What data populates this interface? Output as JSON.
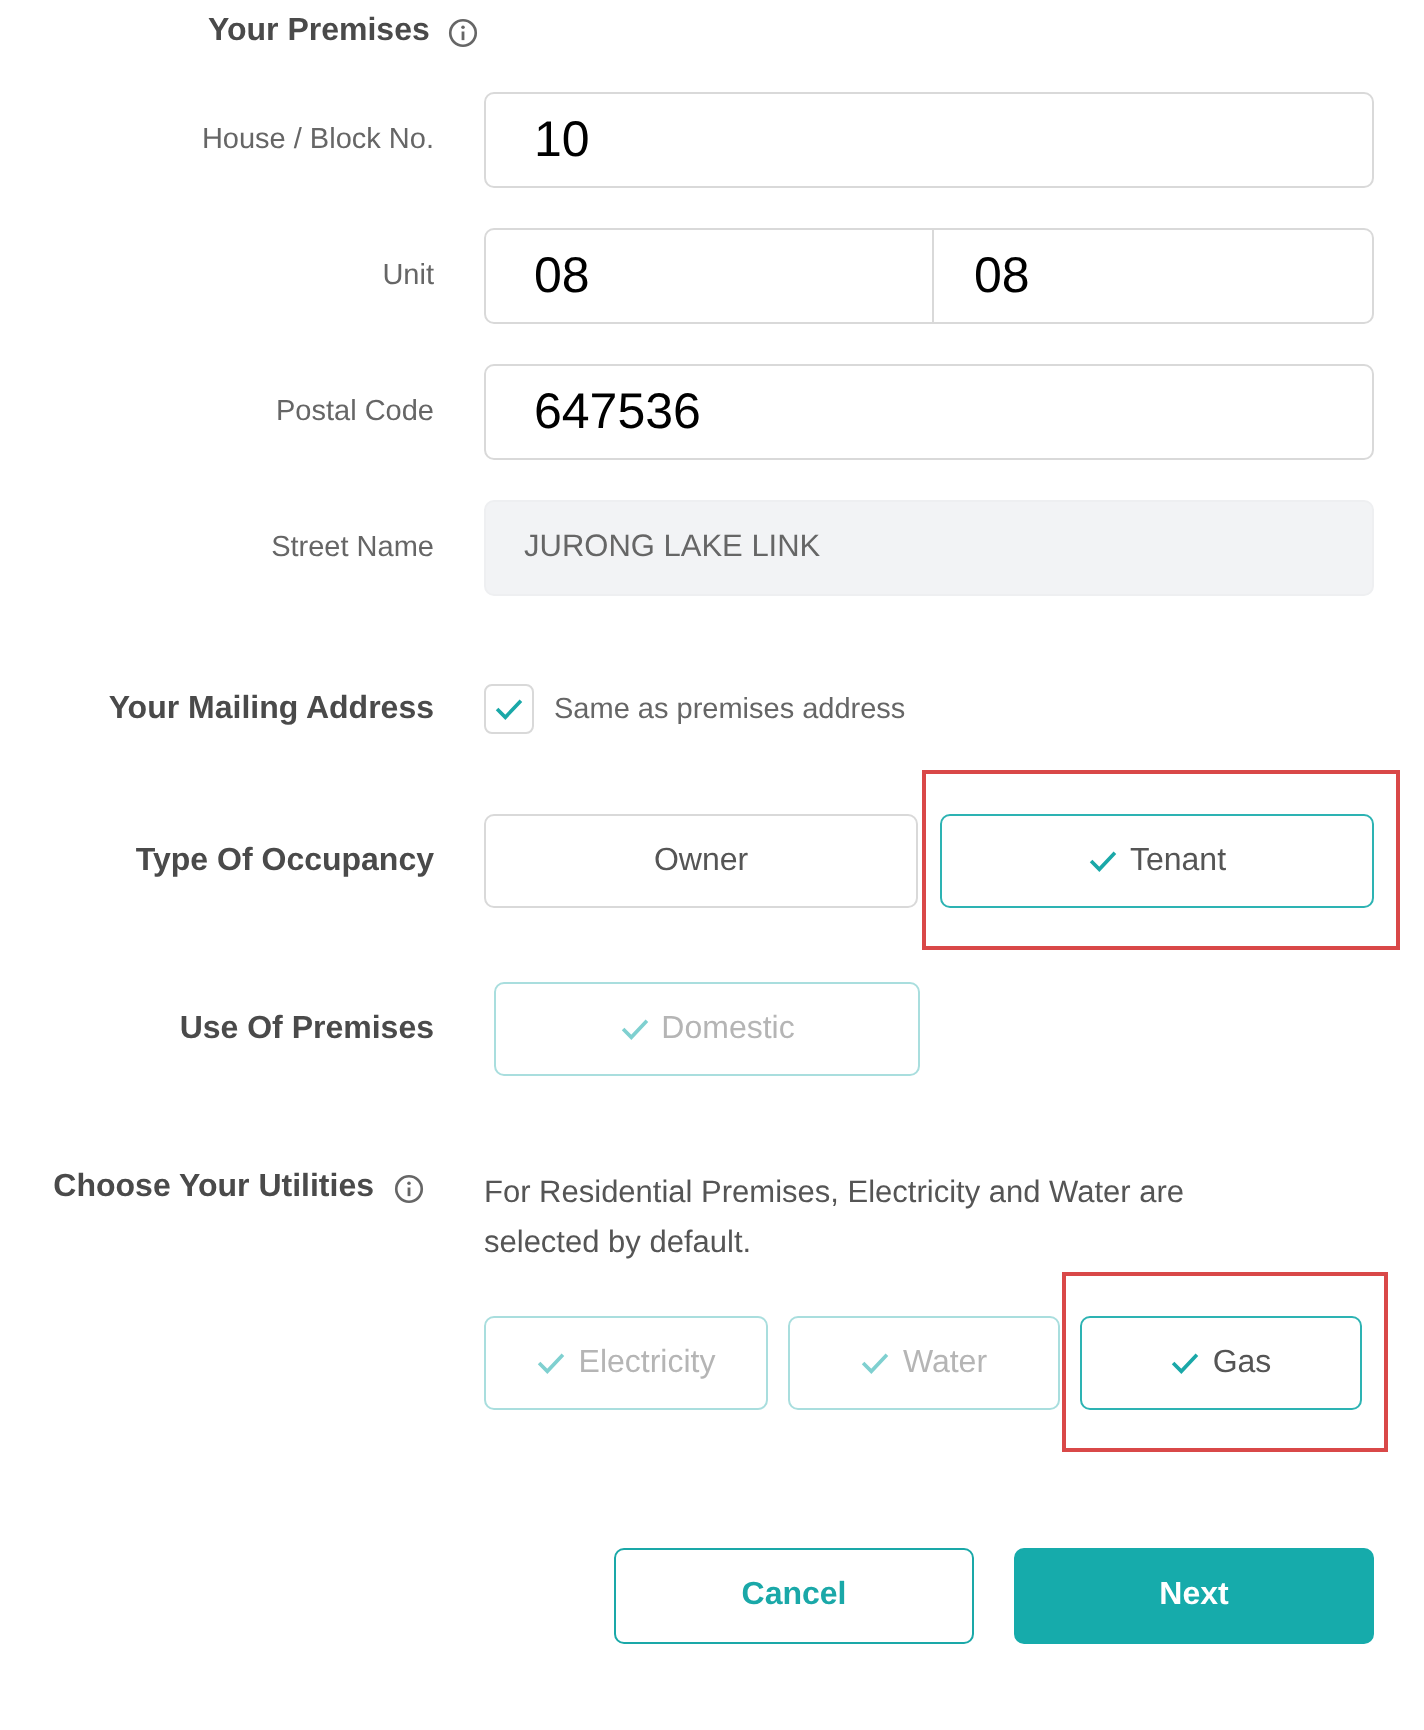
{
  "premises": {
    "title": "Your Premises",
    "fields": [
      {
        "label": "House / Block No.",
        "kind": "text",
        "value": "10"
      },
      {
        "label": "Unit",
        "kind": "split",
        "values": [
          "08",
          "08"
        ]
      },
      {
        "label": "Postal Code",
        "kind": "text",
        "value": "647536"
      },
      {
        "label": "Street Name",
        "kind": "readonly",
        "value": "JURONG LAKE LINK"
      }
    ]
  },
  "mailing_address": {
    "label": "Your Mailing Address",
    "checkbox": {
      "label": "Same as premises address",
      "checked": true
    }
  },
  "occupancy": {
    "label": "Type Of Occupancy",
    "options": [
      {
        "label": "Owner",
        "selected": false,
        "disabled": false,
        "annotated": false
      },
      {
        "label": "Tenant",
        "selected": true,
        "disabled": false,
        "annotated": true
      }
    ]
  },
  "use_of_premises": {
    "label": "Use Of Premises",
    "options": [
      {
        "label": "Domestic",
        "selected": true,
        "disabled": true,
        "annotated": false
      }
    ]
  },
  "utilities": {
    "label": "Choose Your Utilities",
    "note": "For Residential Premises, Electricity and Water are selected by default.",
    "options": [
      {
        "label": "Electricity",
        "selected": true,
        "disabled": true,
        "annotated": false
      },
      {
        "label": "Water",
        "selected": true,
        "disabled": true,
        "annotated": false
      },
      {
        "label": "Gas",
        "selected": true,
        "disabled": false,
        "annotated": true
      }
    ]
  },
  "actions": [
    {
      "label": "Cancel",
      "kind": "secondary"
    },
    {
      "label": "Next",
      "kind": "primary"
    }
  ]
}
